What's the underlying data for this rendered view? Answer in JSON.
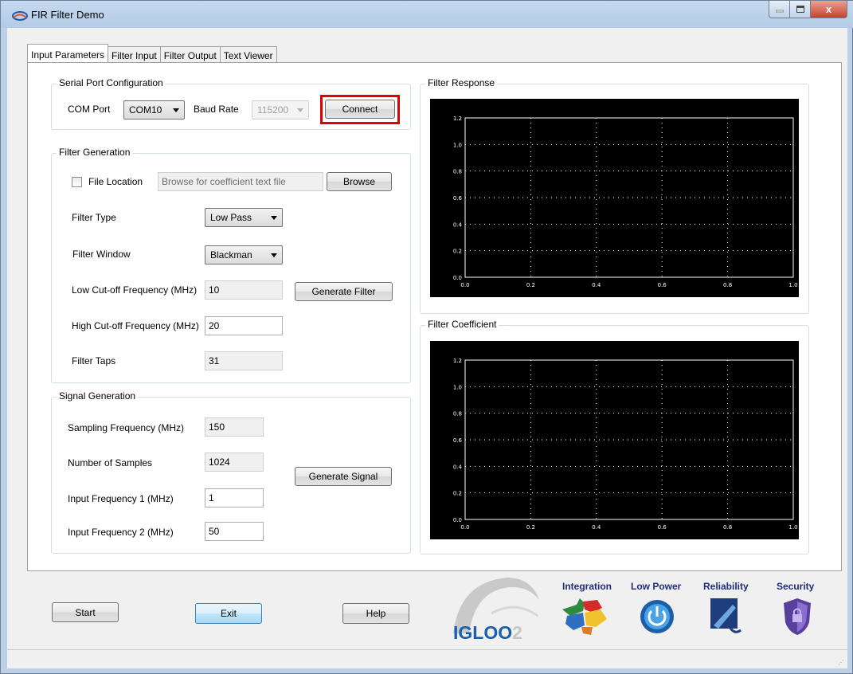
{
  "window": {
    "title": "FIR Filter Demo",
    "controls": {
      "minimize": "–",
      "maximize": "□",
      "close": "x"
    }
  },
  "tabs": [
    {
      "label": "Input Parameters",
      "active": true
    },
    {
      "label": "Filter Input",
      "active": false
    },
    {
      "label": "Filter Output",
      "active": false
    },
    {
      "label": "Text Viewer",
      "active": false
    }
  ],
  "serial": {
    "group_title": "Serial Port Configuration",
    "com_label": "COM Port",
    "com_value": "COM10",
    "baud_label": "Baud Rate",
    "baud_value": "115200",
    "connect_label": "Connect"
  },
  "filter_gen": {
    "group_title": "Filter Generation",
    "file_location_label": "File Location",
    "file_location_checked": false,
    "file_placeholder": "Browse for coefficient text file",
    "browse_label": "Browse",
    "filter_type_label": "Filter Type",
    "filter_type_value": "Low Pass",
    "filter_window_label": "Filter Window",
    "filter_window_value": "Blackman",
    "low_cutoff_label": "Low Cut-off Frequency (MHz)",
    "low_cutoff_value": "10",
    "high_cutoff_label": "High Cut-off Frequency (MHz)",
    "high_cutoff_value": "20",
    "taps_label": "Filter Taps",
    "taps_value": "31",
    "generate_label": "Generate Filter"
  },
  "signal_gen": {
    "group_title": "Signal Generation",
    "sampling_label": "Sampling Frequency (MHz)",
    "sampling_value": "150",
    "samples_label": "Number of Samples",
    "samples_value": "1024",
    "freq1_label": "Input Frequency 1 (MHz)",
    "freq1_value": "1",
    "freq2_label": "Input Frequency 2 (MHz)",
    "freq2_value": "50",
    "generate_label": "Generate Signal"
  },
  "response": {
    "group_title": "Filter Response"
  },
  "coefficient": {
    "group_title": "Filter Coefficient"
  },
  "plot_axes": {
    "x_ticks": [
      "0.0",
      "0.2",
      "0.4",
      "0.6",
      "0.8",
      "1.0"
    ],
    "y_ticks": [
      "0.0",
      "0.2",
      "0.4",
      "0.6",
      "0.8",
      "1.0",
      "1.2"
    ],
    "frame_color": "#ffffff",
    "background": "#000000"
  },
  "buttons": {
    "start": "Start",
    "exit": "Exit",
    "help": "Help"
  },
  "branding": {
    "logo_text": "IGLOO",
    "logo_suffix": "2",
    "features": [
      "Integration",
      "Low Power",
      "Reliability",
      "Security"
    ],
    "feature_icons": [
      "puzzle-icon",
      "power-icon",
      "reliability-icon",
      "shield-lock-icon"
    ]
  },
  "colors": {
    "highlight": "#e00000",
    "brand_blue": "#1f2d7a",
    "logo_blue": "#1b5faa"
  }
}
